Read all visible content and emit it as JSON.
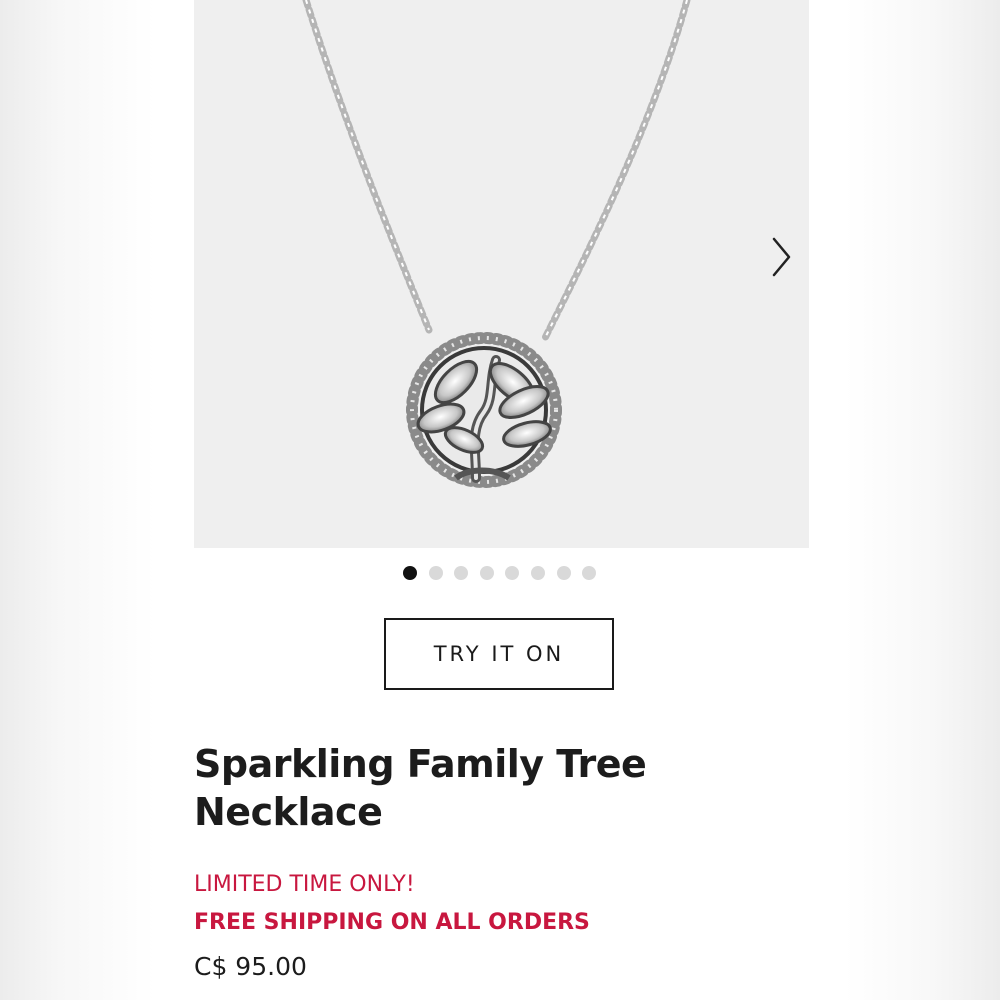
{
  "gallery": {
    "image_icon": "tree-of-life-necklace-image",
    "next_icon": "chevron-right-icon",
    "slide_count": 8,
    "active_slide": 1
  },
  "actions": {
    "try_on_label": "TRY IT ON"
  },
  "product": {
    "title_line1": "Sparkling Family Tree",
    "title_line2": "Necklace",
    "promo_line1": "LIMITED TIME ONLY!",
    "promo_line2": "FREE SHIPPING ON ALL ORDERS",
    "price": "C$ 95.00"
  },
  "colors": {
    "promo": "#c8173f",
    "text": "#1c1c1c",
    "gallery_bg": "#efefef"
  }
}
